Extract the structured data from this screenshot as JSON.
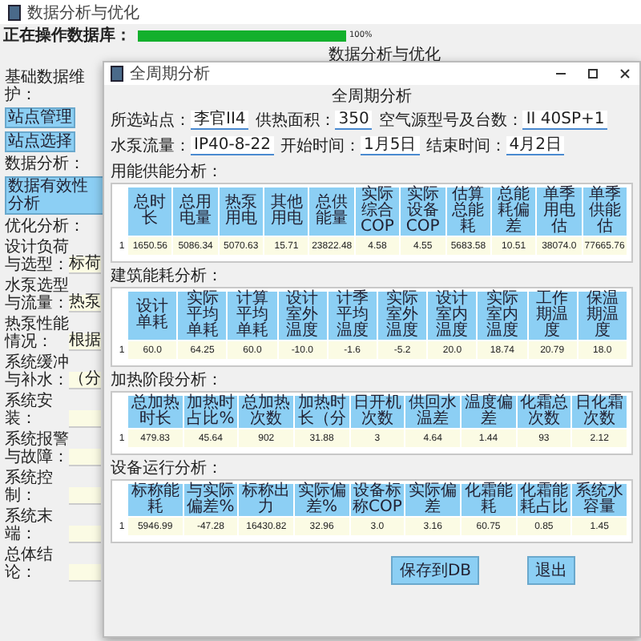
{
  "window": {
    "title": "数据分析与优化"
  },
  "progress": {
    "label": "正在操作数据库：",
    "level": 1.0,
    "reading": "100%"
  },
  "heading": "数据分析与优化",
  "sidebar": {
    "sections": [
      {
        "title": "基础数据维护：",
        "buttons": [
          "站点管理",
          "站点选择"
        ]
      },
      {
        "title": "数据分析：",
        "buttons": [
          "数据有效性分析"
        ]
      },
      {
        "title": "优化分析："
      }
    ],
    "items": [
      {
        "label": "设计负荷与选型：",
        "value": "标荷"
      },
      {
        "label": "水泵选型与流量：",
        "value": "热泵"
      },
      {
        "label": "热泵性能情况：",
        "value": "根据"
      },
      {
        "label": "系统缓冲与补水：",
        "value": "（分"
      },
      {
        "label": "系统安装：",
        "value": ""
      },
      {
        "label": "系统报警与故障：",
        "value": ""
      },
      {
        "label": "系统控制：",
        "value": ""
      },
      {
        "label": "系统末端：",
        "value": ""
      },
      {
        "label": "总体结论：",
        "value": ""
      }
    ]
  },
  "dialog": {
    "title": "全周期分析",
    "heading": "全周期分析",
    "params": [
      {
        "label": "所选站点：",
        "value": "李官II4"
      },
      {
        "label": "供热面积：",
        "value": "350"
      },
      {
        "label": "空气源型号及台数：",
        "value": "II 40SP+1"
      },
      {
        "label": "水泵流量：",
        "value": "IP40-8-22"
      },
      {
        "label": "开始时间：",
        "value": "1月5日"
      },
      {
        "label": "结束时间：",
        "value": "4月2日"
      }
    ],
    "tables": [
      {
        "title": "用能供能分析：",
        "columns": [
          "总时长",
          "总用电量",
          "热泵用电",
          "其他用电",
          "总供能量",
          "实际综合COP",
          "实际设备COP",
          "估算总能耗",
          "总能耗偏差",
          "单季用电估",
          "单季供能估"
        ],
        "rows": [
          {
            "index": "1",
            "cells": [
              "1650.56",
              "5086.34",
              "5070.63",
              "15.71",
              "23822.48",
              "4.58",
              "4.55",
              "5683.58",
              "10.51",
              "38074.0",
              "77665.76"
            ]
          }
        ]
      },
      {
        "title": "建筑能耗分析：",
        "columns": [
          "设计单耗",
          "实际平均单耗",
          "计算平均单耗",
          "设计室外温度",
          "计季平均温度",
          "实际室外温度",
          "设计室内温度",
          "实际室内温度",
          "工作期温度",
          "保温期温度"
        ],
        "rows": [
          {
            "index": "1",
            "cells": [
              "60.0",
              "64.25",
              "60.0",
              "-10.0",
              "-1.6",
              "-5.2",
              "20.0",
              "18.74",
              "20.79",
              "18.0"
            ]
          }
        ]
      },
      {
        "title": "加热阶段分析：",
        "columns": [
          "总加热时长",
          "加热时占比%",
          "总加热次数",
          "加热时长（分",
          "日开机次数",
          "供回水温差",
          "温度偏差",
          "化霜总次数",
          "日化霜次数"
        ],
        "rows": [
          {
            "index": "1",
            "cells": [
              "479.83",
              "45.64",
              "902",
              "31.88",
              "3",
              "4.64",
              "1.44",
              "93",
              "2.12"
            ]
          }
        ]
      },
      {
        "title": "设备运行分析：",
        "columns": [
          "标称能耗",
          "与实际偏差%",
          "标称出力",
          "实际偏差%",
          "设备标称COP",
          "实际偏差",
          "化霜能耗",
          "化霜能耗占比",
          "系统水容量"
        ],
        "rows": [
          {
            "index": "1",
            "cells": [
              "5946.99",
              "-47.28",
              "16430.82",
              "32.96",
              "3.0",
              "3.16",
              "60.75",
              "0.85",
              "1.45"
            ]
          }
        ]
      }
    ],
    "buttons": [
      "保存到DB",
      "退出"
    ]
  }
}
